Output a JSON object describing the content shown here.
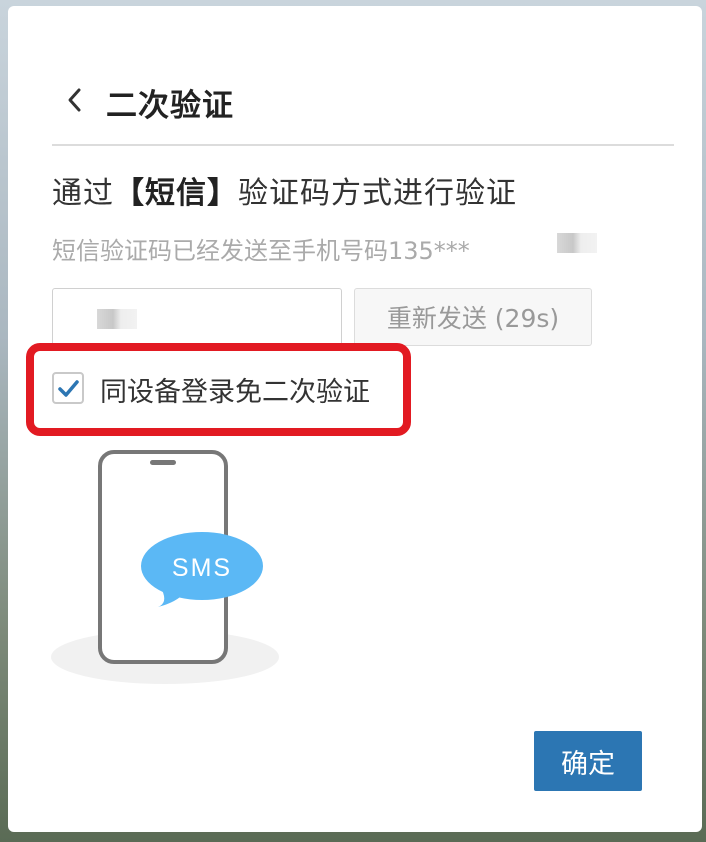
{
  "header": {
    "title": "二次验证",
    "back_icon": "chevron-left-icon"
  },
  "verify": {
    "heading_prefix": "通过",
    "heading_method": "【短信】",
    "heading_suffix": "验证码方式进行验证",
    "sent_to": "短信验证码已经发送至手机号码135***",
    "code_value": "",
    "resend_label": "重新发送 (29s)"
  },
  "remember": {
    "label": "同设备登录免二次验证",
    "checked": true,
    "check_icon": "checkmark-icon"
  },
  "illustration": {
    "bubble_text": "SMS",
    "icon": "phone-sms-icon"
  },
  "actions": {
    "confirm_label": "确定"
  },
  "colors": {
    "primary": "#2c76b3",
    "highlight_border": "#e21a22",
    "bubble": "#5bb8f5"
  }
}
